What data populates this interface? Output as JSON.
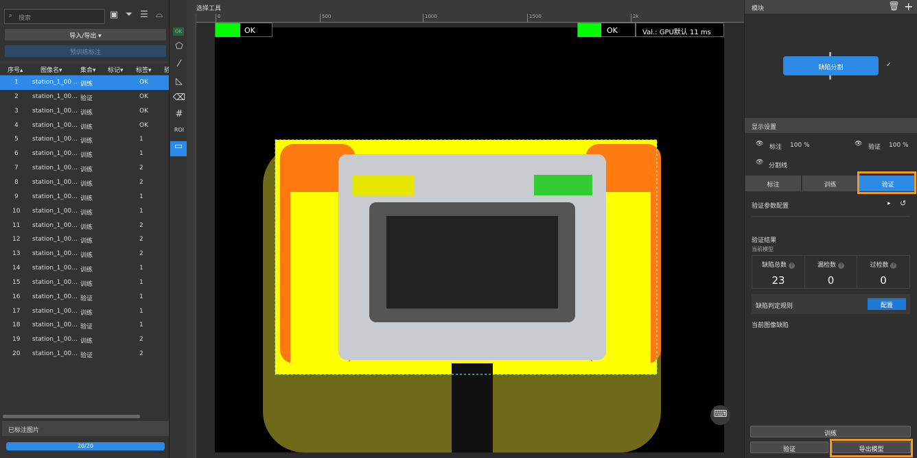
{
  "left": {
    "search_placeholder": "搜索",
    "import_export": "导入/导出 ▾",
    "pretrain": "预训练标注",
    "columns": [
      "序号▴",
      "图像名▾",
      "集合▾",
      "标记▾",
      "标签▾",
      "验"
    ],
    "rows": [
      [
        "1",
        "station_1_00...",
        "训练",
        "OK"
      ],
      [
        "2",
        "station_1_00...",
        "验证",
        "OK"
      ],
      [
        "3",
        "station_1_00...",
        "训练",
        "OK"
      ],
      [
        "4",
        "station_1_00...",
        "训练",
        "OK"
      ],
      [
        "5",
        "station_1_00...",
        "训练",
        "1"
      ],
      [
        "6",
        "station_1_00...",
        "训练",
        "1"
      ],
      [
        "7",
        "station_1_00...",
        "训练",
        "2"
      ],
      [
        "8",
        "station_1_00...",
        "训练",
        "2"
      ],
      [
        "9",
        "station_1_00...",
        "训练",
        "1"
      ],
      [
        "10",
        "station_1_00...",
        "训练",
        "1"
      ],
      [
        "11",
        "station_1_00...",
        "训练",
        "2"
      ],
      [
        "12",
        "station_1_00...",
        "训练",
        "2"
      ],
      [
        "13",
        "station_1_00...",
        "训练",
        "2"
      ],
      [
        "14",
        "station_1_00...",
        "训练",
        "1"
      ],
      [
        "15",
        "station_1_00...",
        "训练",
        "1"
      ],
      [
        "16",
        "station_1_00...",
        "验证",
        "1"
      ],
      [
        "17",
        "station_1_00...",
        "训练",
        "1"
      ],
      [
        "18",
        "station_1_00...",
        "验证",
        "1"
      ],
      [
        "19",
        "station_1_00...",
        "训练",
        "2"
      ],
      [
        "20",
        "station_1_00...",
        "验证",
        "2"
      ]
    ],
    "labeled_title": "已标注图片",
    "progress_text": "20/20",
    "progress": 1.0
  },
  "toolbar": {
    "ok_badge": "OK",
    "roi": "ROI"
  },
  "canvas": {
    "header": "选择工具",
    "ruler_ticks": [
      "0",
      "500",
      "1000",
      "1500",
      "2k"
    ],
    "label_left": "OK",
    "label_right": "OK",
    "val_text": "Val.: GPU默认 11 ms",
    "ok_color": "#00ff00"
  },
  "right": {
    "module_title": "模块",
    "module_node": "缺陷分割",
    "display_title": "显示设置",
    "annot": "标注",
    "annot_pct": "100 %",
    "verify": "验证",
    "verify_pct": "100 %",
    "seg_line": "分割线",
    "tabs": [
      "标注",
      "训练",
      "验证"
    ],
    "param_config": "验证参数配置",
    "result_title": "验证结果",
    "current_model": "当前模型",
    "stats": [
      {
        "label": "缺陷总数",
        "value": "23"
      },
      {
        "label": "漏检数",
        "value": "0"
      },
      {
        "label": "过检数",
        "value": "0"
      }
    ],
    "rule_label": "缺陷判定规则",
    "config_btn": "配置",
    "current_defects": "当前图像缺陷",
    "train_btn": "训练",
    "verify_btn": "验证",
    "export_btn": "导出模型",
    "accent": "#2d8ae6",
    "highlight": "#f39a1f"
  }
}
